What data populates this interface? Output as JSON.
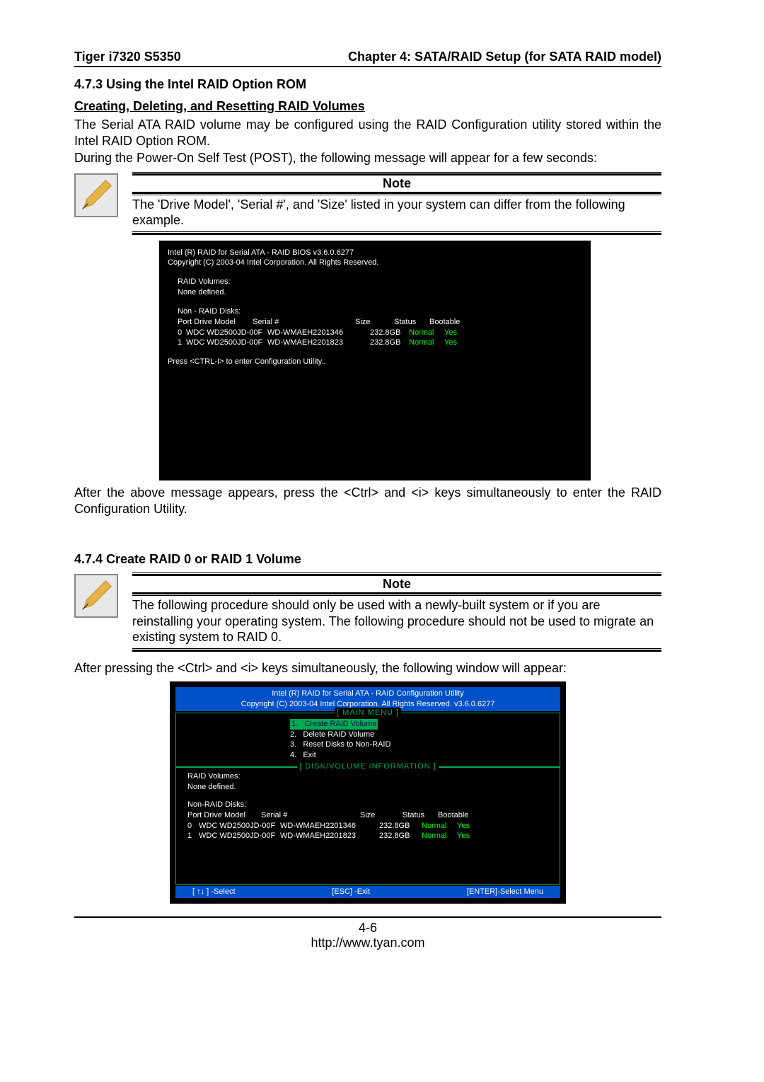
{
  "header": {
    "left": "Tiger i7320 S5350",
    "right": "Chapter 4: SATA/RAID Setup (for SATA RAID model)"
  },
  "section473": {
    "title": "4.7.3 Using the Intel RAID Option ROM",
    "subheading": "Creating, Deleting, and Resetting RAID Volumes",
    "para1": "The Serial ATA RAID volume may be configured using the RAID Configuration utility stored within the Intel RAID Option ROM.",
    "para2": "During the Power-On Self Test (POST), the following message will appear for a few seconds:"
  },
  "note1": {
    "label": "Note",
    "text": "The 'Drive Model', 'Serial #', and 'Size' listed in your system can differ from the following example."
  },
  "bios1": {
    "line1": "Intel (R) RAID for Serial ATA - RAID  BIOS  v3.6.0.6277",
    "line2": "Copyright (C) 2003-04 Intel Corporation. All Rights Reserved.",
    "raid_vol_label": "RAID Volumes:",
    "none_defined": "None defined.",
    "non_raid_label": "Non - RAID Disks:",
    "hdr": {
      "port": "Port Drive Model",
      "serial": "Serial #",
      "size": "Size",
      "status": "Status",
      "boot": "Bootable"
    },
    "rows": [
      {
        "port": "0",
        "model": "WDC WD2500JD-00F",
        "serial": "WD-WMAEH2201346",
        "size": "232.8GB",
        "status": "Normal",
        "boot": "Yes"
      },
      {
        "port": "1",
        "model": "WDC WD2500JD-00F",
        "serial": "WD-WMAEH2201823",
        "size": "232.8GB",
        "status": "Normal",
        "boot": "Yes"
      }
    ],
    "press_line": "Press <CTRL-I> to enter Configuration Utility.."
  },
  "section473_after": "After the above message appears, press the <Ctrl> and <i> keys simultaneously to enter the RAID Configuration Utility.",
  "section474": {
    "title": "4.7.4 Create RAID 0 or RAID 1 Volume"
  },
  "note2": {
    "label": "Note",
    "text": "The following procedure should only be used with a newly-built system or if you are reinstalling your operating system. The following procedure should not be used to migrate an existing system to RAID 0."
  },
  "section474_after": "After pressing the <Ctrl> and <i> keys simultaneously, the following window will appear:",
  "bios2": {
    "title1": "Intel (R) RAID for Serial ATA - RAID Configuration Utility",
    "title2": "Copyright (C) 2003-04 Intel Corporation. All Rights Reserved.  v3.6.0.6277",
    "main_menu_label": "[  MAIN  MENU  ]",
    "menu": [
      "1.   Create RAID Volume",
      "2.   Delete RAID Volume",
      "3.   Reset Disks to Non-RAID",
      "4.   Exit"
    ],
    "disk_info_label": "[  DISK/VOLUME  INFORMATION  ]",
    "raid_vol_label": "RAID Volumes:",
    "none_defined": "None defined.",
    "non_raid_label": "Non-RAID Disks:",
    "hdr": {
      "port": "Port Drive Model",
      "serial": "Serial #",
      "size": "Size",
      "status": "Status",
      "boot": "Bootable"
    },
    "rows": [
      {
        "port": "0",
        "model": "WDC WD2500JD-00F",
        "serial": "WD-WMAEH2201346",
        "size": "232.8GB",
        "status": "Normal",
        "boot": "Yes"
      },
      {
        "port": "1",
        "model": "WDC WD2500JD-00F",
        "serial": "WD-WMAEH2201823",
        "size": "232.8GB",
        "status": "Normal",
        "boot": "Yes"
      }
    ],
    "foot": {
      "select": "[ ↑↓ ] -Select",
      "esc": "[ESC] -Exit",
      "enter": "[ENTER]-Select  Menu"
    }
  },
  "footer": {
    "page": "4-6",
    "url": "http://www.tyan.com"
  }
}
